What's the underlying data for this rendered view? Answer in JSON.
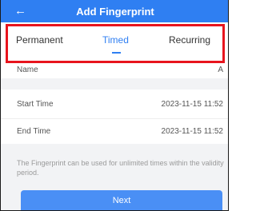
{
  "header": {
    "title": "Add Fingerprint",
    "back_icon": "arrow-left-icon"
  },
  "tabs": [
    {
      "label": "Permanent",
      "active": false
    },
    {
      "label": "Timed",
      "active": true
    },
    {
      "label": "Recurring",
      "active": false
    }
  ],
  "form": {
    "name": {
      "label": "Name",
      "value": "A"
    },
    "start_time": {
      "label": "Start Time",
      "value": "2023-11-15 11:52"
    },
    "end_time": {
      "label": "End Time",
      "value": "2023-11-15 11:52"
    }
  },
  "note": "The Fingerprint can be used for unlimited times within the validity period.",
  "next_label": "Next",
  "colors": {
    "accent": "#2f7ff2",
    "highlight": "#e8141d",
    "background": "#f2f3f5"
  }
}
